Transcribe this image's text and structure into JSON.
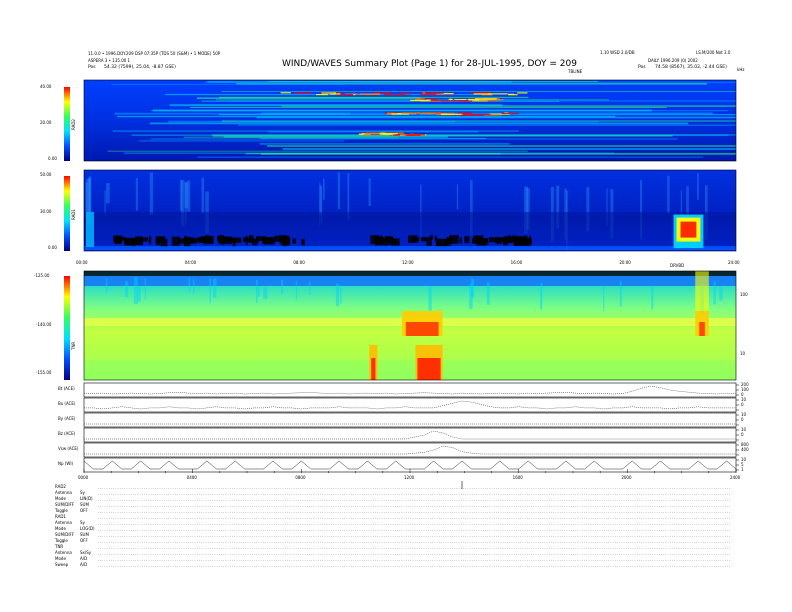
{
  "header": {
    "left_line1": "11.0.0 • 1996.DOY.209 DSP 07:35P  (TDS 50 (S&M) • 1 MODE) 50P",
    "left_line2": "ASPERA 3 • 135.00 1",
    "left_pos_label": "Pos",
    "left_pos_value": "54.32 (7599), 25.04, -8.87 GSE)",
    "title": "WIND/WAVES Summary Plot (Page 1) for 28-JUL-1995, DOY = 209",
    "right_line1": "1.10 WSD 2.0/DB",
    "right_line1b": "LS.M/200 Not 3.0",
    "right_line2": "DAILY 1996.209 (0) 2002",
    "right_pos_label": "Pos",
    "right_pos_value": "74.58 (8567), 35.02, -2.44 GSE)",
    "corner_unit": "kHz"
  },
  "panels": {
    "rad2": {
      "label": "RAD2",
      "ticks": [
        "40.00",
        "20.00",
        "0.00"
      ],
      "marker": "TBLINE"
    },
    "rad1": {
      "label": "RAD1",
      "ticks": [
        "50.00",
        "30.00",
        "0.00"
      ]
    },
    "tnr": {
      "label": "TNR",
      "ticks": [
        "-125.00",
        "-140.00",
        "-155.00"
      ],
      "right_ticks": [
        "100",
        "10"
      ],
      "marker": "DRVBD"
    },
    "time_labels": [
      "00:00",
      "04:00",
      "08:00",
      "12:00",
      "16:00",
      "20:00",
      "24:00"
    ]
  },
  "line_panels": {
    "labels": [
      "Bt (ACE)",
      "Bx (ACE)",
      "By (ACE)",
      "Bz (ACE)",
      "Vsw (ACE)",
      "Np (WI)"
    ],
    "right_ticks": [
      [
        "200",
        "100",
        "0"
      ],
      [
        "10",
        "0"
      ],
      [
        "10",
        "0"
      ],
      [
        "10",
        "0"
      ],
      [
        "800",
        "400"
      ],
      [
        "10",
        "5",
        "1"
      ]
    ],
    "time_labels": [
      "0000",
      "0400",
      "0800",
      "1200",
      "1600",
      "2000",
      "2400"
    ]
  },
  "footer": {
    "rows": [
      {
        "k": "RAD2",
        "v": ""
      },
      {
        "k": "Antenna",
        "v": "Sy"
      },
      {
        "k": "Mode",
        "v": "LIN(D)"
      },
      {
        "k": "SUM/DIFF",
        "v": "SUM"
      },
      {
        "k": "Toggle",
        "v": "OFF"
      },
      {
        "k": "RAD1",
        "v": ""
      },
      {
        "k": "Antenna",
        "v": "Sy"
      },
      {
        "k": "Mode",
        "v": "LOG(D)"
      },
      {
        "k": "SUM/DIFF",
        "v": "SUM"
      },
      {
        "k": "Toggle",
        "v": "OFF"
      },
      {
        "k": "TNR",
        "v": ""
      },
      {
        "k": "Antenna",
        "v": "Sx/Sy"
      },
      {
        "k": "Mode",
        "v": "A/D"
      },
      {
        "k": "Sweep",
        "v": "A/D"
      }
    ]
  },
  "colors": {
    "spectrum_low": "#0000b4",
    "spectrum_mid": "#00ff00",
    "spectrum_high": "#ff0000",
    "tnr_background": "#a0ff60"
  },
  "chart_data": [
    {
      "type": "heatmap",
      "title": "RAD2",
      "xlabel": "",
      "ylabel": "RAD2",
      "ylim": [
        0,
        40
      ],
      "x_range_hours": [
        0,
        24
      ],
      "x_ticks": [
        "00:00",
        "04:00",
        "08:00",
        "12:00",
        "16:00",
        "20:00",
        "24:00"
      ],
      "colorscale": [
        "#0000b4",
        "#0060ff",
        "#00e0ff",
        "#00ff00",
        "#ffff00",
        "#ff0000"
      ],
      "intense_bands_y": [
        34,
        31,
        24,
        14
      ],
      "intense_bands_x_hours": [
        [
          7.2,
          16.0
        ],
        [
          12.0,
          15.0
        ],
        [
          10.0,
          15.5
        ],
        [
          10.0,
          12.0
        ]
      ]
    },
    {
      "type": "heatmap",
      "title": "RAD1",
      "xlabel": "",
      "ylabel": "RAD1",
      "ylim": [
        0,
        50
      ],
      "x_range_hours": [
        0,
        24
      ],
      "x_ticks": [
        "00:00",
        "04:00",
        "08:00",
        "12:00",
        "16:00",
        "20:00",
        "24:00"
      ],
      "dark_band_y": 8,
      "dark_band_x_hours": [
        [
          10.5,
          16.5
        ],
        [
          1.0,
          8.0
        ]
      ],
      "burst_x_hours": [
        21.7,
        22.8
      ],
      "burst_y_range": [
        3,
        20
      ]
    },
    {
      "type": "heatmap",
      "title": "TNR",
      "ylabel": "TNR",
      "ylim": [
        -155,
        -125
      ],
      "x_range_hours": [
        0,
        24
      ],
      "x_ticks": [
        "00:00",
        "04:00",
        "08:00",
        "12:00",
        "16:00",
        "20:00",
        "24:00"
      ],
      "background_level_db": -145,
      "emission_x_hours": [
        [
          11.7,
          13.2
        ],
        [
          22.5,
          23.0
        ]
      ],
      "low_band_burst_x_hours": [
        [
          10.5,
          10.8
        ],
        [
          12.2,
          13.2
        ]
      ]
    },
    {
      "type": "line",
      "series": [
        {
          "name": "Bt (ACE)",
          "values": [
            88,
            87,
            88,
            86,
            87,
            88,
            87,
            86,
            87,
            89,
            90,
            88,
            87,
            88,
            86,
            87,
            88,
            86,
            87,
            88,
            86,
            87,
            88,
            89,
            90,
            88,
            87,
            88,
            86,
            87,
            88,
            87,
            88,
            86,
            87,
            88,
            89,
            88,
            87,
            86,
            88,
            87,
            86,
            87,
            88,
            87,
            86,
            88,
            87,
            88,
            89,
            90,
            88,
            87,
            88,
            87,
            86,
            87,
            92,
            99,
            104,
            100,
            95,
            92,
            90,
            88,
            87,
            86,
            88,
            87
          ]
        },
        {
          "name": "Bx (ACE)",
          "values": [
            2,
            2,
            1,
            2,
            3,
            2,
            1,
            2,
            2,
            3,
            2,
            2,
            1,
            2,
            3,
            2,
            2,
            1,
            2,
            2,
            3,
            2,
            2,
            1,
            2,
            2,
            2,
            3,
            2,
            2,
            2,
            1,
            2,
            2,
            3,
            2,
            2,
            2,
            4,
            6,
            8,
            7,
            5,
            3,
            2,
            2,
            3,
            2,
            2,
            1,
            2,
            2,
            3,
            2,
            2,
            1,
            2,
            2,
            3,
            2,
            2,
            2,
            1,
            2,
            2,
            3,
            2,
            2,
            2,
            2
          ]
        },
        {
          "name": "By (ACE)",
          "values": [
            1,
            1,
            1,
            1,
            1,
            1,
            1,
            1,
            1,
            1,
            1,
            1,
            1,
            1,
            1,
            1,
            1,
            1,
            1,
            1,
            1,
            1,
            1,
            1,
            1,
            1,
            1,
            1,
            1,
            1,
            1,
            1,
            1,
            1,
            1,
            1,
            1,
            1,
            1,
            1,
            1,
            1,
            1,
            1,
            1,
            1,
            1,
            1,
            1,
            1,
            1,
            1,
            1,
            1,
            1,
            1,
            1,
            1,
            1,
            1,
            1,
            1,
            1,
            1,
            1,
            1,
            1,
            1,
            1,
            1
          ]
        },
        {
          "name": "Bz (ACE)",
          "values": [
            1,
            1,
            1,
            1,
            1,
            1,
            1,
            1,
            1,
            1,
            1,
            1,
            1,
            1,
            1,
            1,
            1,
            1,
            1,
            1,
            1,
            1,
            1,
            1,
            1,
            1,
            1,
            1,
            1,
            1,
            1,
            1,
            1,
            1,
            1,
            2,
            3,
            5,
            4,
            2,
            1,
            1,
            1,
            1,
            1,
            1,
            1,
            1,
            1,
            1,
            1,
            1,
            1,
            1,
            1,
            1,
            1,
            1,
            1,
            1,
            1,
            1,
            1,
            1,
            1,
            1,
            1,
            1,
            1,
            1
          ]
        },
        {
          "name": "Vsw (ACE)",
          "values": [
            420,
            420,
            420,
            420,
            420,
            420,
            420,
            420,
            420,
            420,
            420,
            420,
            420,
            420,
            420,
            420,
            420,
            420,
            420,
            420,
            420,
            420,
            420,
            420,
            420,
            420,
            420,
            420,
            420,
            420,
            420,
            420,
            420,
            420,
            420,
            430,
            440,
            470,
            520,
            500,
            450,
            430,
            420,
            420,
            420,
            420,
            420,
            420,
            420,
            420,
            420,
            420,
            420,
            420,
            420,
            420,
            420,
            420,
            420,
            420,
            420,
            420,
            420,
            420,
            420,
            420,
            420,
            420,
            420,
            420
          ]
        },
        {
          "name": "Np (WI)",
          "values": [
            3,
            2,
            2,
            3,
            2,
            2,
            3,
            2,
            2,
            3,
            2,
            2,
            2,
            3,
            2,
            2,
            3,
            2,
            2,
            2,
            3,
            2,
            2,
            3,
            2,
            2,
            2,
            3,
            2,
            2,
            3,
            2,
            2,
            3,
            2,
            2,
            2,
            3,
            2,
            2,
            3,
            2,
            2,
            2,
            3,
            2,
            2,
            3,
            2,
            2,
            2,
            3,
            2,
            2,
            3,
            2,
            2,
            2,
            3,
            2,
            2,
            3,
            2,
            2,
            2,
            3,
            2,
            2,
            3,
            2
          ]
        }
      ]
    }
  ]
}
